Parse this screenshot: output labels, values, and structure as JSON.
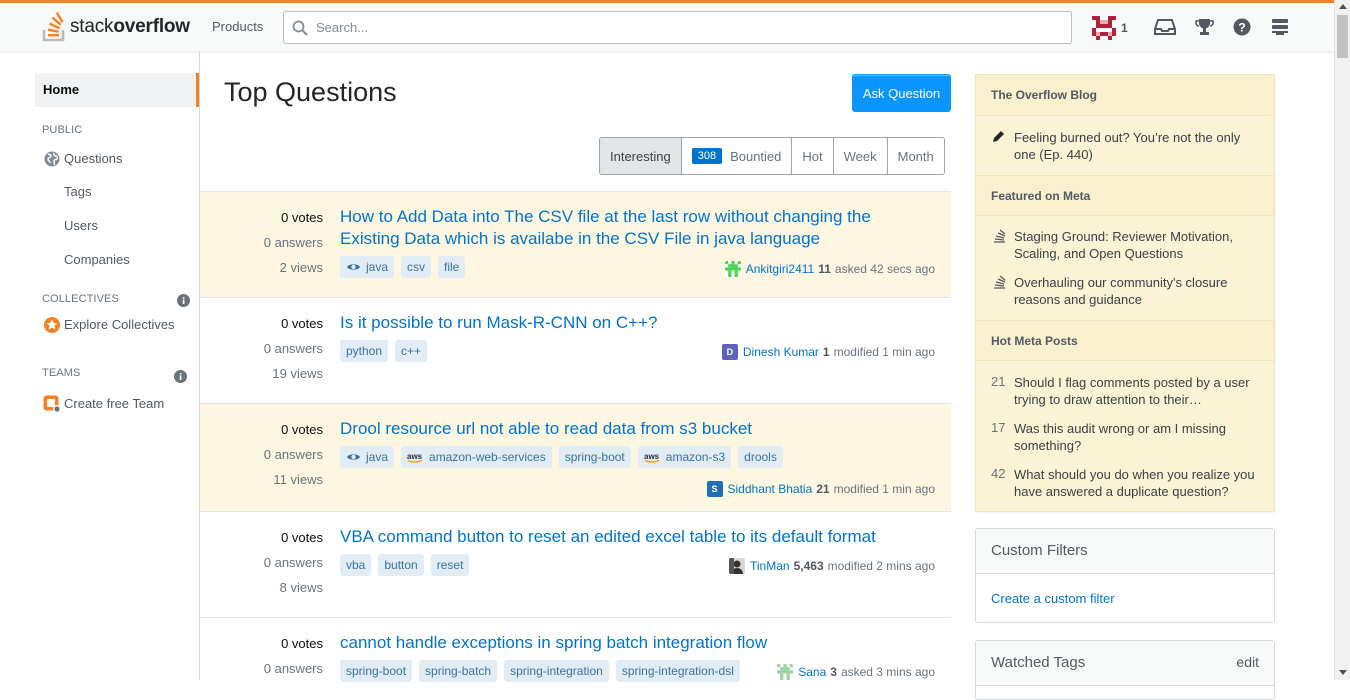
{
  "header": {
    "logo_light": "stack",
    "logo_bold": "overflow",
    "products_label": "Products",
    "search_placeholder": "Search...",
    "user_reputation": "1",
    "icons": [
      "inbox-icon",
      "achievements-icon",
      "help-icon",
      "site-switcher-icon"
    ],
    "accent_color": "#f48225"
  },
  "leftnav": {
    "home": "Home",
    "public_label": "PUBLIC",
    "items": [
      "Questions",
      "Tags",
      "Users",
      "Companies"
    ],
    "collectives_label": "COLLECTIVES",
    "explore_collectives": "Explore Collectives",
    "teams_label": "TEAMS",
    "create_team": "Create free Team"
  },
  "main": {
    "title": "Top Questions",
    "ask_button": "Ask Question",
    "filters": [
      "Interesting",
      "Bountied",
      "Hot",
      "Week",
      "Month"
    ],
    "bounty_count": "308",
    "questions": [
      {
        "votes": "0 votes",
        "answers": "0 answers",
        "views": "2 views",
        "title": "How to Add Data into The CSV file at the last row without changing the Existing Data which is availabe in the CSV File in java language",
        "tags": [
          "java",
          "csv",
          "file"
        ],
        "user": "Ankitgiri2411",
        "rep": "11",
        "action": "asked 42 secs ago",
        "highlighted": true
      },
      {
        "votes": "0 votes",
        "answers": "0 answers",
        "views": "19 views",
        "title": "Is it possible to run Mask-R-CNN on C++?",
        "tags": [
          "python",
          "c++"
        ],
        "user": "Dinesh Kumar",
        "rep": "1",
        "action": "modified 1 min ago",
        "avatar_letter": "D",
        "highlighted": false
      },
      {
        "votes": "0 votes",
        "answers": "0 answers",
        "views": "11 views",
        "title": "Drool resource url not able to read data from s3 bucket",
        "tags": [
          "java",
          "amazon-web-services",
          "spring-boot",
          "amazon-s3",
          "drools"
        ],
        "user": "Siddhant Bhatia",
        "rep": "21",
        "action": "modified 1 min ago",
        "avatar_letter": "S",
        "highlighted": true
      },
      {
        "votes": "0 votes",
        "answers": "0 answers",
        "views": "8 views",
        "title": "VBA command button to reset an edited excel table to its default format",
        "tags": [
          "vba",
          "button",
          "reset"
        ],
        "user": "TinMan",
        "rep": "5,463",
        "action": "modified 2 mins ago",
        "highlighted": false
      },
      {
        "votes": "0 votes",
        "answers": "0 answers",
        "views": "",
        "title": "cannot handle exceptions in spring batch integration flow",
        "tags": [
          "spring-boot",
          "spring-batch",
          "spring-integration",
          "spring-integration-dsl"
        ],
        "user": "Sana",
        "rep": "3",
        "action": "asked 3 mins ago",
        "highlighted": false
      }
    ]
  },
  "sidebar": {
    "blog_title": "The Overflow Blog",
    "blog_items": [
      "Feeling burned out? You’re not the only one (Ep. 440)"
    ],
    "meta_title": "Featured on Meta",
    "meta_items": [
      "Staging Ground: Reviewer Motivation, Scaling, and Open Questions",
      "Overhauling our community's closure reasons and guidance"
    ],
    "hot_title": "Hot Meta Posts",
    "hot_items": [
      {
        "count": "21",
        "text": "Should I flag comments posted by a user trying to draw attention to their…"
      },
      {
        "count": "17",
        "text": "Was this audit wrong or am I missing something?"
      },
      {
        "count": "42",
        "text": "What should you do when you realize you have answered a duplicate question?"
      }
    ],
    "custom_filters_title": "Custom Filters",
    "create_filter": "Create a custom filter",
    "watched_tags_title": "Watched Tags",
    "watched_edit": "edit"
  }
}
